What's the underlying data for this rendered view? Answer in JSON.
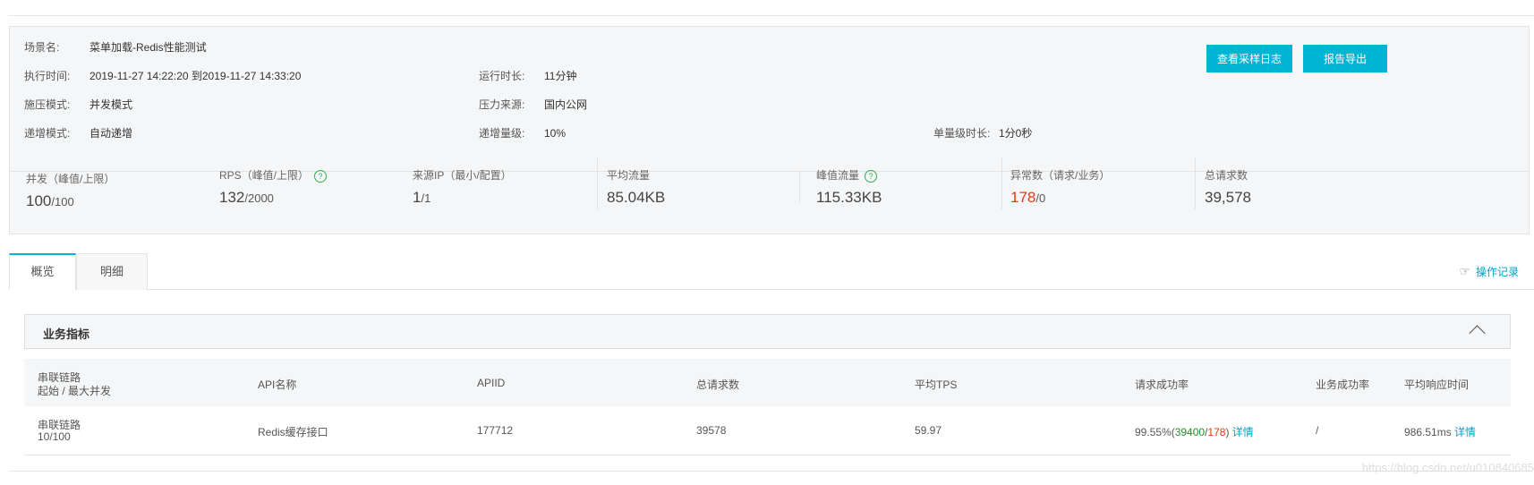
{
  "scenario": {
    "name_label": "场景名:",
    "name_value": "菜单加载-Redis性能测试",
    "exec_label": "执行时间:",
    "exec_value": "2019-11-27 14:22:20 到2019-11-27 14:33:20",
    "duration_label": "运行时长:",
    "duration_value": "11分钟",
    "mode_label": "施压模式:",
    "mode_value": "并发模式",
    "source_label": "压力来源:",
    "source_value": "国内公网",
    "ramp_label": "递增模式:",
    "ramp_value": "自动递增",
    "step_label": "递增量级:",
    "step_value": "10%",
    "level_duration_label": "单量级时长:",
    "level_duration_value": "1分0秒"
  },
  "buttons": {
    "logs": "查看采样日志",
    "export": "报告导出"
  },
  "stats": [
    {
      "label": "并发（峰值/上限）",
      "main": "100",
      "sub": "/100"
    },
    {
      "label": "RPS（峰值/上限）",
      "main": "132",
      "sub": "/2000"
    },
    {
      "label": "来源IP（最小/配置）",
      "main": "1",
      "sub": "/1"
    },
    {
      "label": "平均流量",
      "main": "85.04KB",
      "sub": ""
    },
    {
      "label": "峰值流量",
      "main": "115.33KB",
      "sub": ""
    },
    {
      "label": "异常数（请求/业务）",
      "main": "178",
      "sub": "/0"
    },
    {
      "label": "总请求数",
      "main": "39,578",
      "sub": ""
    }
  ],
  "tabs": [
    {
      "label": "概览"
    },
    {
      "label": "明细"
    }
  ],
  "oplog": "操作记录",
  "panel": {
    "title": "业务指标"
  },
  "table": {
    "headers": {
      "chain": "串联链路",
      "chain_sub": "起始 / 最大并发",
      "api_name": "API名称",
      "api_id": "APIID",
      "total": "总请求数",
      "tps": "平均TPS",
      "success_rate": "请求成功率",
      "biz_rate": "业务成功率",
      "resp_time": "平均响应时间"
    },
    "row": {
      "chain": "串联链路",
      "chain_sub": "10/100",
      "api_name": "Redis缓存接口",
      "api_id": "177712",
      "total": "39578",
      "tps": "59.97",
      "rate_pct": "99.55%",
      "rate_ok": "39400",
      "rate_fail": "178",
      "detail1": "详情",
      "biz_rate": "/",
      "resp_time": "986.51ms",
      "detail2": "详情"
    }
  },
  "watermark": "https://blog.csdn.net/u010840685",
  "colors": {
    "accent": "#00b4d4",
    "link": "#00a2ca",
    "error": "#e8380d",
    "success": "#2a8c2a"
  }
}
